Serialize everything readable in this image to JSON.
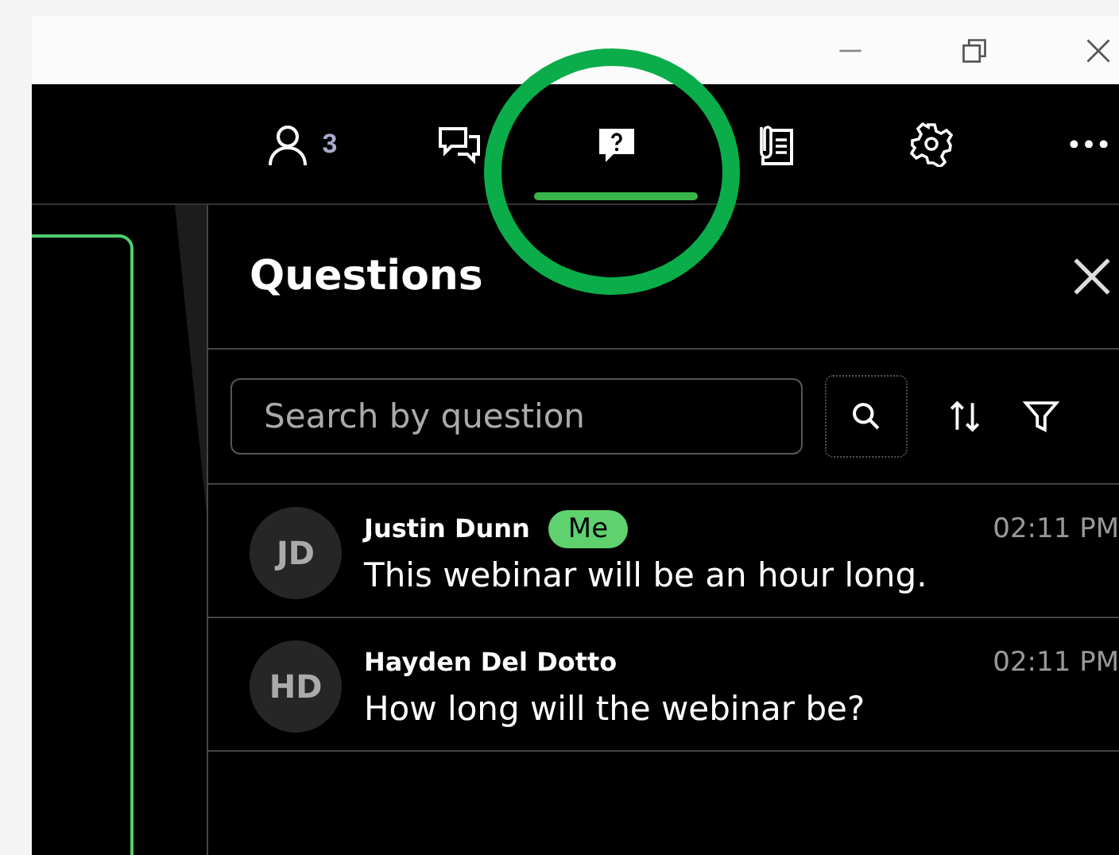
{
  "toolbar": {
    "tabs": [
      {
        "kind": "participants",
        "count": "3",
        "selected": false
      },
      {
        "kind": "chat",
        "selected": false
      },
      {
        "kind": "questions",
        "selected": true
      },
      {
        "kind": "notes",
        "selected": false
      },
      {
        "kind": "settings",
        "selected": false
      },
      {
        "kind": "more",
        "selected": false
      }
    ]
  },
  "panel": {
    "title": "Questions",
    "search": {
      "placeholder": "Search by question"
    },
    "questions": [
      {
        "initials": "JD",
        "name": "Justin Dunn",
        "badge": "Me",
        "time": "02:11 PM",
        "text": "This webinar will be an hour long."
      },
      {
        "initials": "HD",
        "name": "Hayden Del Dotto",
        "time": "02:11 PM",
        "text": "How long will the webinar be?"
      }
    ]
  }
}
